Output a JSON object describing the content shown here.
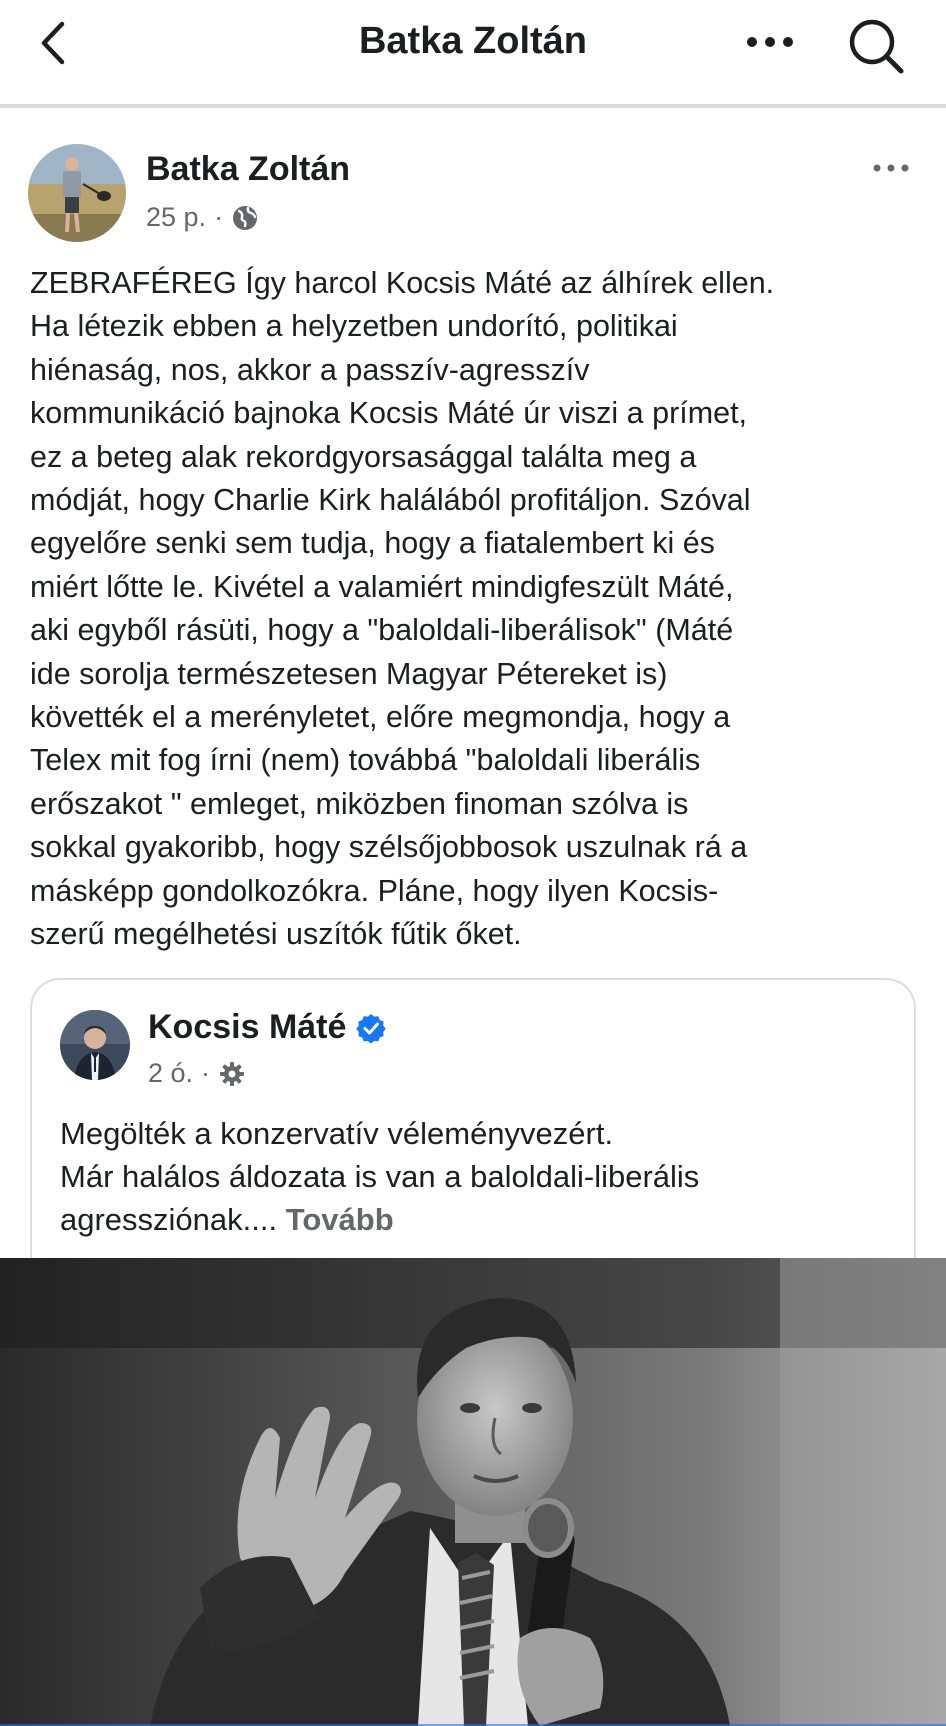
{
  "header": {
    "title": "Batka Zoltán",
    "back_icon": "chevron-left-icon",
    "more_icon": "ellipsis-icon",
    "search_icon": "search-icon"
  },
  "post": {
    "author": "Batka Zoltán",
    "time": "25 p.",
    "separator": "·",
    "audience_icon": "globe-icon",
    "text": "ZEBRAFÉREG Így harcol Kocsis Máté az álhírek ellen.\nHa létezik ebben a helyzetben undorító, politikai\nhiénaság, nos, akkor a passzív-agresszív\nkommunikáció bajnoka Kocsis Máté úr viszi a prímet,\nez a beteg alak rekordgyorsasággal találta meg a\nmódját, hogy Charlie Kirk halálából profitáljon. Szóval\negyelőre senki sem tudja, hogy a fiatalembert ki és\nmiért lőtte le. Kivétel a valamiért mindigfeszült Máté,\naki egyből rásüti, hogy a \"baloldali-liberálisok\" (Máté\nide sorolja természetesen Magyar Pétereket is)\nkövették el a merényletet, előre megmondja, hogy a\nTelex mit fog írni (nem) továbbá \"baloldali liberális\nerőszakot \" emleget, miközben finoman szólva is\nsokkal gyakoribb, hogy szélsőjobbosok uszulnak rá a\nmásképp gondolkozókra. Pláne, hogy ilyen Kocsis-\nszerű megélhetési uszítók fűtik őket."
  },
  "shared": {
    "author": "Kocsis Máté",
    "verified_icon": "verified-badge-icon",
    "time": "2 ó.",
    "separator": "·",
    "audience_icon": "gear-icon",
    "text": "Megölték a konzervatív véleményvezért.\nMár halálos áldozata is van a baloldali-liberális\nagressziónak.... ",
    "see_more": "Tovább"
  },
  "colors": {
    "text": "#1c1e21",
    "secondary": "#65676b",
    "divider": "#d9dadc",
    "verified": "#1877f2"
  }
}
